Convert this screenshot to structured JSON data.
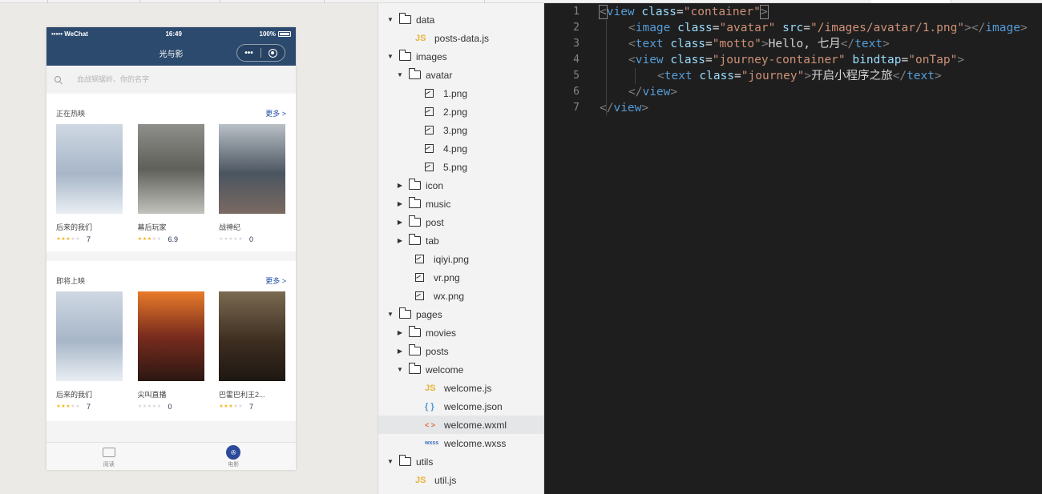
{
  "simulator": {
    "status": {
      "carrier": "••••• WeChat",
      "time": "16:49",
      "battery": "100%"
    },
    "nav": {
      "title": "光与影",
      "menu_label": "•••"
    },
    "search": {
      "placeholder": "血战钢锯岭、你的名字"
    },
    "sections": [
      {
        "title": "正在热映",
        "more": "更多 >",
        "movies": [
          {
            "name": "后来的我们",
            "score": "7",
            "stars_on": 3,
            "poster": "后来的我们"
          },
          {
            "name": "幕后玩家",
            "score": "6.9",
            "stars_on": 3,
            "poster": "幕后玩家"
          },
          {
            "name": "战神纪",
            "score": "0",
            "stars_on": 0,
            "poster": "战神纪"
          }
        ]
      },
      {
        "title": "即将上映",
        "more": "更多 >",
        "movies": [
          {
            "name": "后来的我们",
            "score": "7",
            "stars_on": 3,
            "poster": "后来的我们"
          },
          {
            "name": "尖叫直播",
            "score": "0",
            "stars_on": 0,
            "poster": "尖叫直播"
          },
          {
            "name": "巴霍巴利王2...",
            "score": "7",
            "stars_on": 3,
            "poster": "巴霍巴利王"
          }
        ]
      }
    ],
    "tabs": [
      {
        "label": "阅读",
        "active": false
      },
      {
        "label": "电影",
        "active": true
      }
    ],
    "colors": {
      "nav": "#2c4a6e",
      "accent": "#1f4ba5",
      "star": "#f3b41a"
    }
  },
  "tree": [
    {
      "label": "data",
      "type": "folder",
      "open": true,
      "depth": 0
    },
    {
      "label": "posts-data.js",
      "type": "js",
      "depth": 1
    },
    {
      "label": "images",
      "type": "folder",
      "open": true,
      "depth": 0
    },
    {
      "label": "avatar",
      "type": "folder",
      "open": true,
      "depth": 1
    },
    {
      "label": "1.png",
      "type": "img",
      "depth": 2
    },
    {
      "label": "2.png",
      "type": "img",
      "depth": 2
    },
    {
      "label": "3.png",
      "type": "img",
      "depth": 2
    },
    {
      "label": "4.png",
      "type": "img",
      "depth": 2
    },
    {
      "label": "5.png",
      "type": "img",
      "depth": 2
    },
    {
      "label": "icon",
      "type": "folder",
      "open": false,
      "depth": 1
    },
    {
      "label": "music",
      "type": "folder",
      "open": false,
      "depth": 1
    },
    {
      "label": "post",
      "type": "folder",
      "open": false,
      "depth": 1
    },
    {
      "label": "tab",
      "type": "folder",
      "open": false,
      "depth": 1
    },
    {
      "label": "iqiyi.png",
      "type": "img",
      "depth": 1
    },
    {
      "label": "vr.png",
      "type": "img",
      "depth": 1
    },
    {
      "label": "wx.png",
      "type": "img",
      "depth": 1
    },
    {
      "label": "pages",
      "type": "folder",
      "open": true,
      "depth": 0
    },
    {
      "label": "movies",
      "type": "folder",
      "open": false,
      "depth": 1
    },
    {
      "label": "posts",
      "type": "folder",
      "open": false,
      "depth": 1
    },
    {
      "label": "welcome",
      "type": "folder",
      "open": true,
      "depth": 1
    },
    {
      "label": "welcome.js",
      "type": "js",
      "depth": 2
    },
    {
      "label": "welcome.json",
      "type": "json",
      "depth": 2
    },
    {
      "label": "welcome.wxml",
      "type": "wxml",
      "depth": 2,
      "selected": true
    },
    {
      "label": "welcome.wxss",
      "type": "wxss",
      "depth": 2
    },
    {
      "label": "utils",
      "type": "folder",
      "open": true,
      "depth": 0
    },
    {
      "label": "util.js",
      "type": "js",
      "depth": 1
    }
  ],
  "icon_labels": {
    "js": "JS",
    "json": "{ }",
    "wxml": "< >",
    "wxss": "wxss",
    "open_arrow": "▼",
    "closed_arrow": "▶"
  },
  "editor": {
    "lines": [
      {
        "n": "1",
        "indent": 0,
        "tokens": [
          [
            "b",
            "<"
          ],
          [
            "tag",
            "view"
          ],
          [
            "txt",
            " "
          ],
          [
            "attr",
            "class"
          ],
          [
            "txt",
            "="
          ],
          [
            "str",
            "\"container\""
          ],
          [
            "b",
            ">"
          ]
        ]
      },
      {
        "n": "2",
        "indent": 1,
        "tokens": [
          [
            "b",
            "<"
          ],
          [
            "tag",
            "image"
          ],
          [
            "txt",
            " "
          ],
          [
            "attr",
            "class"
          ],
          [
            "txt",
            "="
          ],
          [
            "str",
            "\"avatar\""
          ],
          [
            "txt",
            " "
          ],
          [
            "attr",
            "src"
          ],
          [
            "txt",
            "="
          ],
          [
            "str",
            "\"/images/avatar/1.png\""
          ],
          [
            "b",
            ">"
          ],
          [
            "b",
            "</"
          ],
          [
            "tag",
            "image"
          ],
          [
            "b",
            ">"
          ]
        ]
      },
      {
        "n": "3",
        "indent": 1,
        "tokens": [
          [
            "b",
            "<"
          ],
          [
            "tag",
            "text"
          ],
          [
            "txt",
            " "
          ],
          [
            "attr",
            "class"
          ],
          [
            "txt",
            "="
          ],
          [
            "str",
            "\"motto\""
          ],
          [
            "b",
            ">"
          ],
          [
            "txt",
            "Hello, 七月"
          ],
          [
            "b",
            "</"
          ],
          [
            "tag",
            "text"
          ],
          [
            "b",
            ">"
          ]
        ]
      },
      {
        "n": "4",
        "indent": 1,
        "tokens": [
          [
            "b",
            "<"
          ],
          [
            "tag",
            "view"
          ],
          [
            "txt",
            " "
          ],
          [
            "attr",
            "class"
          ],
          [
            "txt",
            "="
          ],
          [
            "str",
            "\"journey-container\""
          ],
          [
            "txt",
            " "
          ],
          [
            "attr",
            "bindtap"
          ],
          [
            "txt",
            "="
          ],
          [
            "str",
            "\"onTap\""
          ],
          [
            "b",
            ">"
          ]
        ]
      },
      {
        "n": "5",
        "indent": 2,
        "tokens": [
          [
            "b",
            "<"
          ],
          [
            "tag",
            "text"
          ],
          [
            "txt",
            " "
          ],
          [
            "attr",
            "class"
          ],
          [
            "txt",
            "="
          ],
          [
            "str",
            "\"journey\""
          ],
          [
            "b",
            ">"
          ],
          [
            "txt",
            "开启小程序之旅"
          ],
          [
            "b",
            "</"
          ],
          [
            "tag",
            "text"
          ],
          [
            "b",
            ">"
          ]
        ]
      },
      {
        "n": "6",
        "indent": 1,
        "tokens": [
          [
            "b",
            "</"
          ],
          [
            "tag",
            "view"
          ],
          [
            "b",
            ">"
          ]
        ]
      },
      {
        "n": "7",
        "indent": 0,
        "tokens": [
          [
            "b",
            "</"
          ],
          [
            "tag",
            "view"
          ],
          [
            "b",
            ">"
          ]
        ]
      }
    ]
  }
}
